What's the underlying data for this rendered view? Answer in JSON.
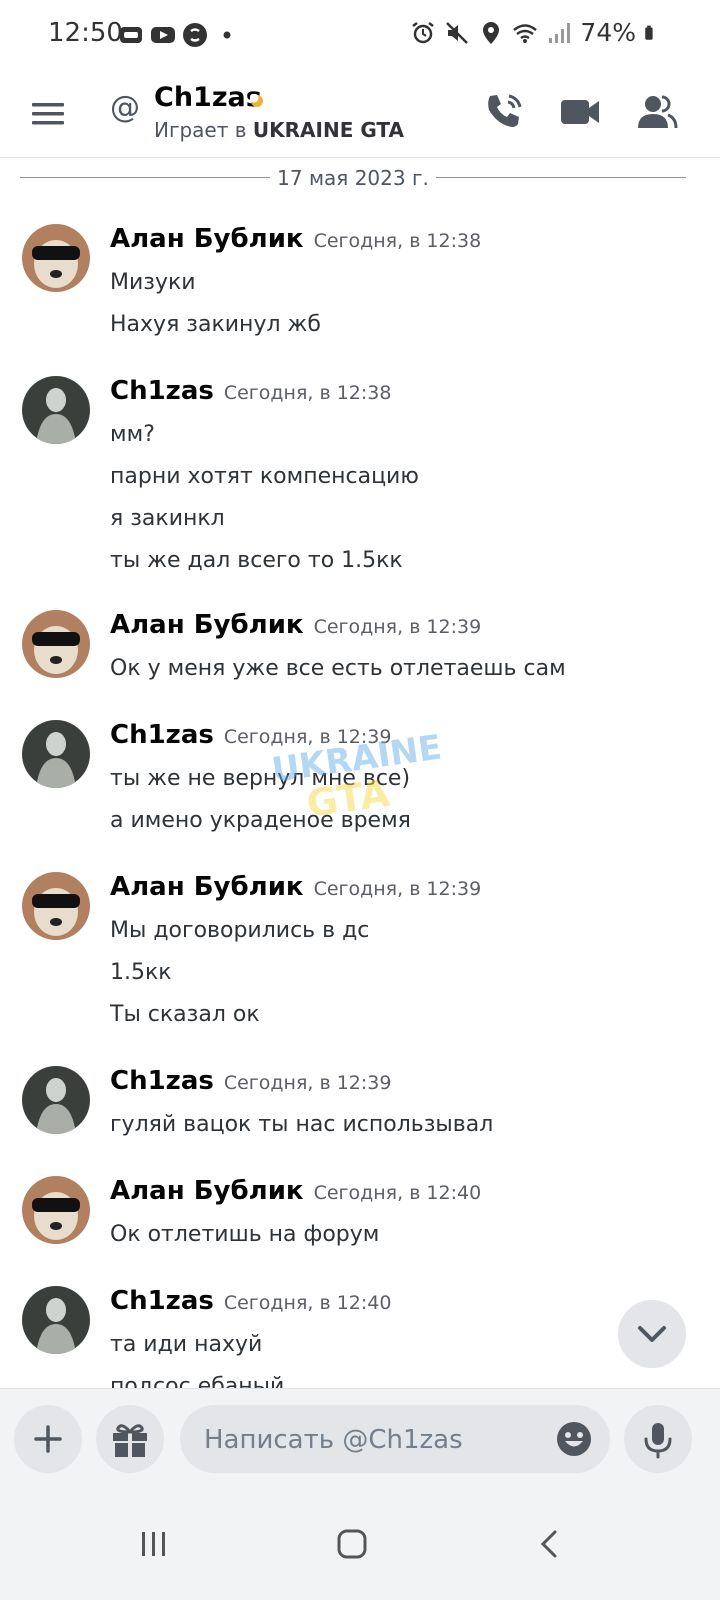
{
  "status_bar": {
    "time": "12:50",
    "battery": "74%",
    "left_icons": [
      "sim-card-icon",
      "youtube-icon",
      "shazam-icon",
      "dot-icon"
    ],
    "right_icons": [
      "alarm-icon",
      "mute-icon",
      "location-icon",
      "wifi-icon",
      "signal-icon",
      "battery-icon"
    ]
  },
  "header": {
    "title": "Ch1zas",
    "subtitle_prefix": "Играет в",
    "subtitle_game": "UKRAINE GTA",
    "at_symbol": "@"
  },
  "date_divider": "17 мая 2023 г.",
  "messages": [
    {
      "author": "Алан Бублик",
      "time": "Сегодня, в 12:38",
      "lines": [
        "Мизуки",
        "Нахуя закинул жб"
      ]
    },
    {
      "author": "Ch1zas",
      "time": "Сегодня, в 12:38",
      "lines": [
        "мм?",
        "парни хотят компенсацию",
        "я закинкл",
        "ты же дал всего то 1.5кк"
      ]
    },
    {
      "author": "Алан Бублик",
      "time": "Сегодня, в 12:39",
      "lines": [
        "Ок у меня уже все есть отлетаешь сам"
      ]
    },
    {
      "author": "Ch1zas",
      "time": "Сегодня, в 12:39",
      "lines": [
        "ты же не вернул мне все)",
        "а имено украденое время"
      ]
    },
    {
      "author": "Алан Бублик",
      "time": "Сегодня, в 12:39",
      "lines": [
        "Мы договорились в дс",
        "1.5кк",
        "Ты сказал ок"
      ]
    },
    {
      "author": "Ch1zas",
      "time": "Сегодня, в 12:39",
      "lines": [
        "гуляй вацок ты нас использывал"
      ]
    },
    {
      "author": "Алан Бублик",
      "time": "Сегодня, в 12:40",
      "lines": [
        "Ок отлетишь на форум"
      ]
    },
    {
      "author": "Ch1zas",
      "time": "Сегодня, в 12:40",
      "lines": [
        "та иди нахуй",
        "подсос ебаный"
      ]
    }
  ],
  "watermark": {
    "line1": "UKRAINE",
    "line2": "GTA"
  },
  "composer": {
    "placeholder": "Написать @Ch1zas"
  },
  "colors": {
    "accent_moon": "#f0b232",
    "text_primary": "#060607",
    "text_muted": "#5c5e66"
  }
}
